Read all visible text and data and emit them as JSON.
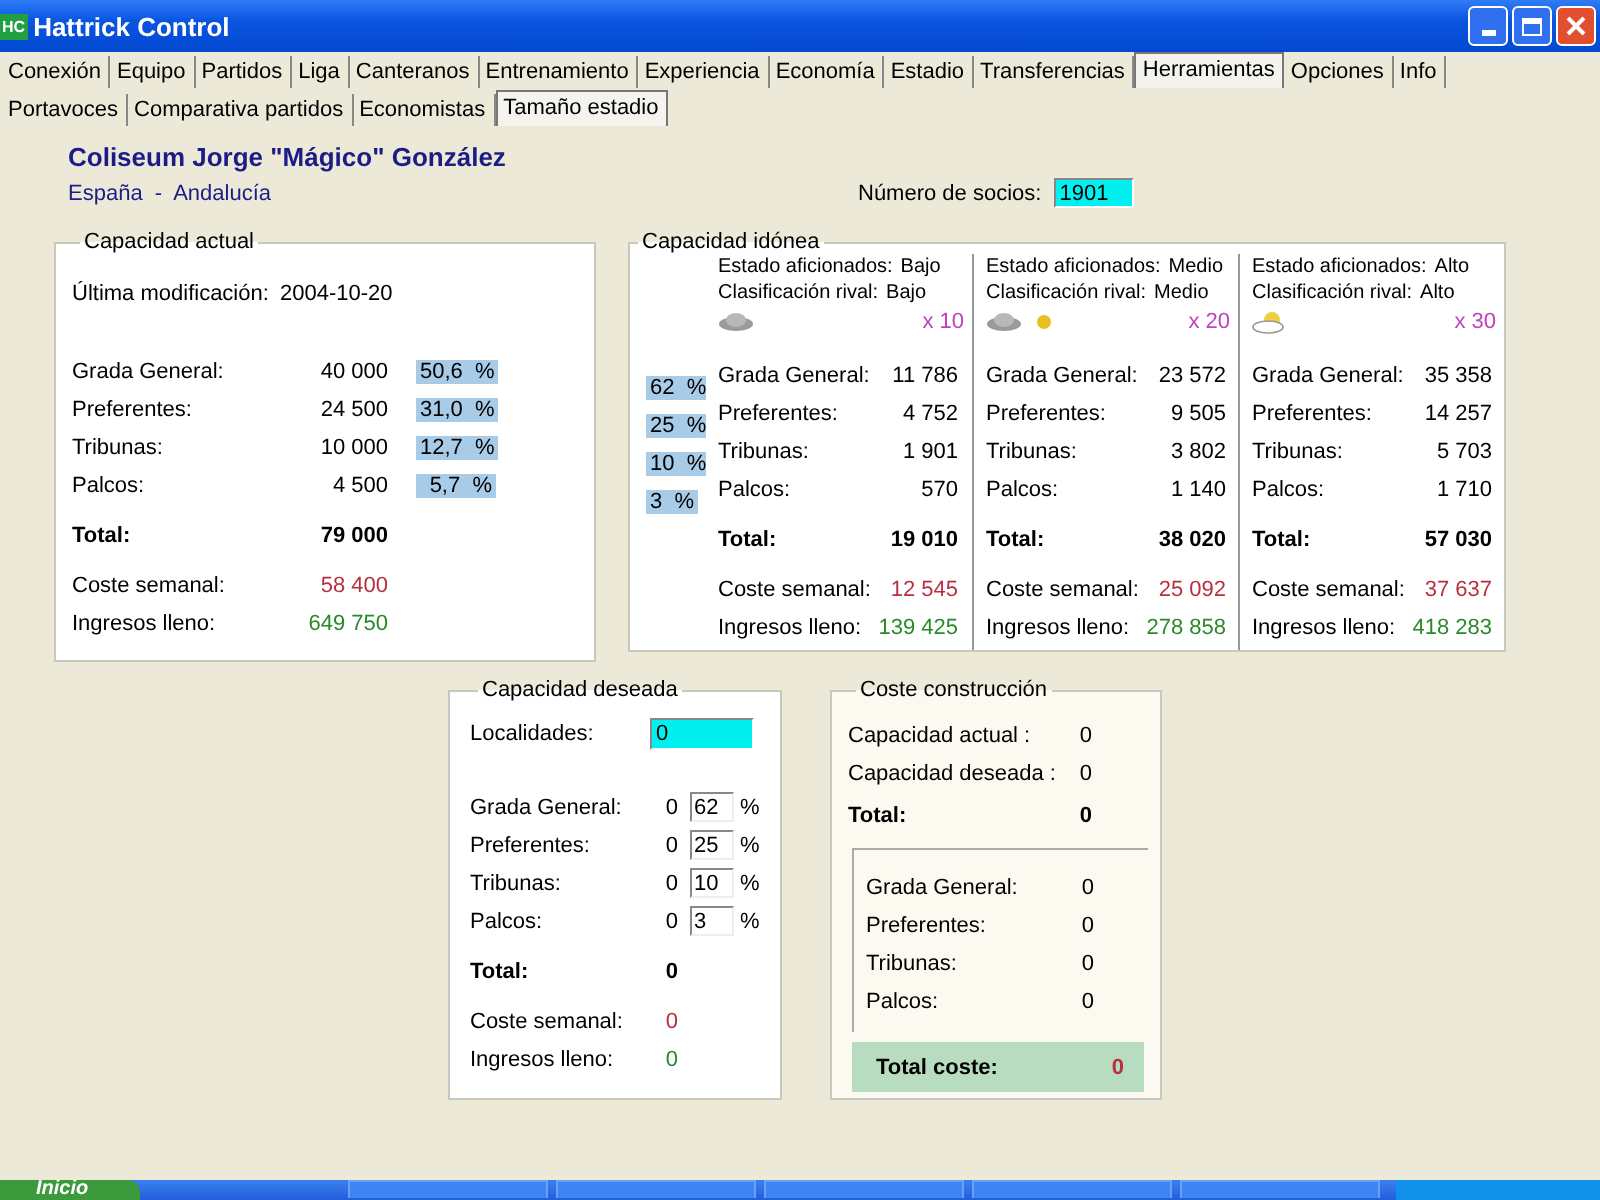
{
  "window": {
    "icon_text": "HC",
    "title": "Hattrick Control"
  },
  "tabs": [
    {
      "label": "Conexión",
      "selected": false
    },
    {
      "label": "Equipo",
      "selected": false
    },
    {
      "label": "Partidos",
      "selected": false
    },
    {
      "label": "Liga",
      "selected": false
    },
    {
      "label": "Canteranos",
      "selected": false
    },
    {
      "label": "Entrenamiento",
      "selected": false
    },
    {
      "label": "Experiencia",
      "selected": false
    },
    {
      "label": "Economía",
      "selected": false
    },
    {
      "label": "Estadio",
      "selected": false
    },
    {
      "label": "Transferencias",
      "selected": false
    },
    {
      "label": "Herramientas",
      "selected": true
    },
    {
      "label": "Opciones",
      "selected": false
    },
    {
      "label": "Info",
      "selected": false
    }
  ],
  "subtabs": [
    {
      "label": "Portavoces",
      "selected": false
    },
    {
      "label": "Comparativa partidos",
      "selected": false
    },
    {
      "label": "Economistas",
      "selected": false
    },
    {
      "label": "Tamaño estadio",
      "selected": true
    }
  ],
  "stadium": {
    "name": "Coliseum Jorge \"Mágico\" González",
    "region": "España  -  Andalucía",
    "members_label": "Número de socios:",
    "members": "1901"
  },
  "current": {
    "title": "Capacidad actual",
    "modified_label": "Última modificación:",
    "modified": "2004-10-20",
    "rows": [
      {
        "label": "Grada General:",
        "value": "40 000",
        "percent": "50,6  %"
      },
      {
        "label": "Preferentes:",
        "value": "24 500",
        "percent": "31,0  %"
      },
      {
        "label": "Tribunas:",
        "value": "10 000",
        "percent": "12,7  %"
      },
      {
        "label": "Palcos:",
        "value": "4 500",
        "percent": "5,7  %"
      }
    ],
    "total_label": "Total:",
    "total": "79 000",
    "cost_label": "Coste semanal:",
    "cost": "58 400",
    "income_label": "Ingresos lleno:",
    "income": "649 750"
  },
  "ideal": {
    "title": "Capacidad idónea",
    "percents": [
      "62  %",
      "25  %",
      "10  %",
      "3  %"
    ],
    "columns": [
      {
        "fans_label": "Estado aficionados:",
        "fans": "Bajo",
        "rival_label": "Clasificación rival:",
        "rival": "Bajo",
        "weather": [
          {
            "kind": "cloud"
          }
        ],
        "multiplier": "x 10",
        "rows": [
          {
            "label": "Grada General:",
            "value": "11 786"
          },
          {
            "label": "Preferentes:",
            "value": "4 752"
          },
          {
            "label": "Tribunas:",
            "value": "1 901"
          },
          {
            "label": "Palcos:",
            "value": "570"
          }
        ],
        "total_label": "Total:",
        "total": "19 010",
        "cost_label": "Coste semanal:",
        "cost": "12 545",
        "income_label": "Ingresos lleno:",
        "income": "139 425"
      },
      {
        "fans_label": "Estado aficionados:",
        "fans": "Medio",
        "rival_label": "Clasificación rival:",
        "rival": "Medio",
        "weather": [
          {
            "kind": "cloud"
          },
          {
            "kind": "sun"
          }
        ],
        "multiplier": "x 20",
        "rows": [
          {
            "label": "Grada General:",
            "value": "23 572"
          },
          {
            "label": "Preferentes:",
            "value": "9 505"
          },
          {
            "label": "Tribunas:",
            "value": "3 802"
          },
          {
            "label": "Palcos:",
            "value": "1 140"
          }
        ],
        "total_label": "Total:",
        "total": "38 020",
        "cost_label": "Coste semanal:",
        "cost": "25 092",
        "income_label": "Ingresos lleno:",
        "income": "278 858"
      },
      {
        "fans_label": "Estado aficionados:",
        "fans": "Alto",
        "rival_label": "Clasificación rival:",
        "rival": "Alto",
        "weather": [
          {
            "kind": "sun-cloud"
          }
        ],
        "multiplier": "x 30",
        "rows": [
          {
            "label": "Grada General:",
            "value": "35 358"
          },
          {
            "label": "Preferentes:",
            "value": "14 257"
          },
          {
            "label": "Tribunas:",
            "value": "5 703"
          },
          {
            "label": "Palcos:",
            "value": "1 710"
          }
        ],
        "total_label": "Total:",
        "total": "57 030",
        "cost_label": "Coste semanal:",
        "cost": "37 637",
        "income_label": "Ingresos lleno:",
        "income": "418 283"
      }
    ]
  },
  "desired": {
    "title": "Capacidad deseada",
    "seats_label": "Localidades:",
    "seats": "0",
    "rows": [
      {
        "label": "Grada General:",
        "value": "0",
        "percent": "62",
        "unit": "%"
      },
      {
        "label": "Preferentes:",
        "value": "0",
        "percent": "25",
        "unit": "%"
      },
      {
        "label": "Tribunas:",
        "value": "0",
        "percent": "10",
        "unit": "%"
      },
      {
        "label": "Palcos:",
        "value": "0",
        "percent": "3",
        "unit": "%"
      }
    ],
    "total_label": "Total:",
    "total": "0",
    "cost_label": "Coste semanal:",
    "cost": "0",
    "income_label": "Ingresos lleno:",
    "income": "0"
  },
  "construction": {
    "title": "Coste construcción",
    "rows": [
      {
        "label": "Capacidad actual :",
        "value": "0"
      },
      {
        "label": "Capacidad deseada :",
        "value": "0"
      }
    ],
    "total_label": "Total:",
    "total": "0",
    "detail_rows": [
      {
        "label": "Grada General:",
        "value": "0"
      },
      {
        "label": "Preferentes:",
        "value": "0"
      },
      {
        "label": "Tribunas:",
        "value": "0"
      },
      {
        "label": "Palcos:",
        "value": "0"
      }
    ],
    "total_cost_label": "Total coste:",
    "total_cost": "0"
  },
  "taskbar": {
    "start": "Inicio"
  }
}
